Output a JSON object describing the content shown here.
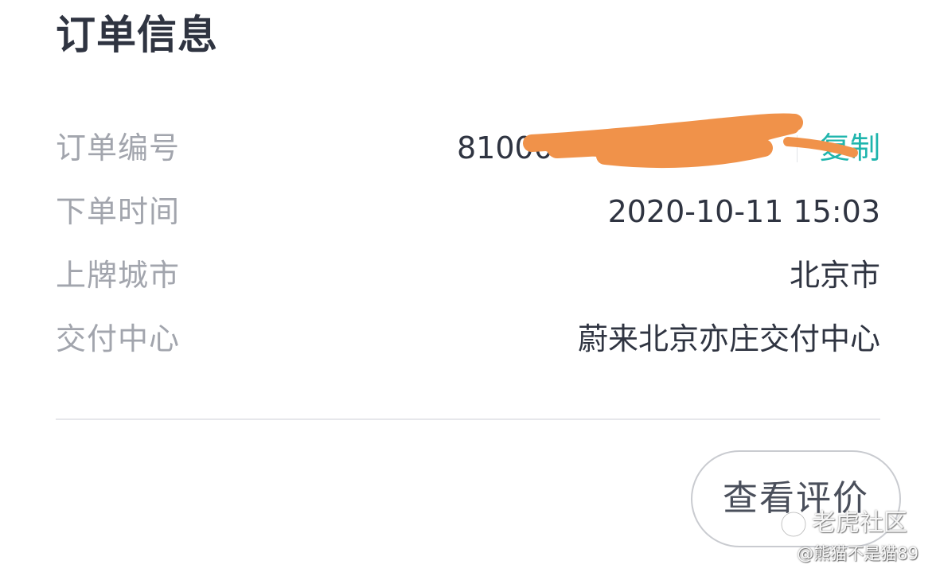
{
  "header": {
    "title": "订单信息"
  },
  "order_info": {
    "rows": [
      {
        "label": "订单编号",
        "value": "81000"
      },
      {
        "label": "下单时间",
        "value": "2020-10-11 15:03"
      },
      {
        "label": "上牌城市",
        "value": "北京市"
      },
      {
        "label": "交付中心",
        "value": "蔚来北京亦庄交付中心"
      }
    ],
    "copy_label": "复制"
  },
  "actions": {
    "review_label": "查看评价"
  },
  "watermark": {
    "brand": "老虎社区",
    "user": "@熊猫不是猫89"
  },
  "colors": {
    "title": "#2f3441",
    "label": "#a2a5ad",
    "value": "#2f3441",
    "accent": "#1fb5ad",
    "redaction": "#f0924a",
    "divider": "#e6e7eb"
  }
}
